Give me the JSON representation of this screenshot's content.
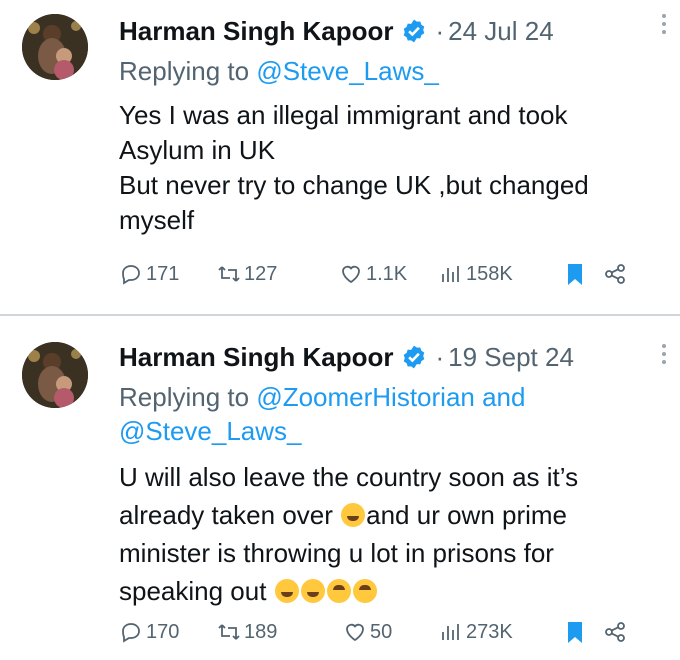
{
  "tweets": [
    {
      "author": "Harman Singh Kapoor",
      "date": "24 Jul 24",
      "reply_prefix": "Replying to ",
      "reply_handles": "@Steve_Laws_",
      "text_lines": [
        "Yes I was an illegal immigrant and took",
        "Asylum in UK",
        "But never try to change UK ,but changed",
        "myself"
      ],
      "replies": "171",
      "retweets": "127",
      "likes": "1.1K",
      "views": "158K"
    },
    {
      "author": "Harman Singh Kapoor",
      "date": "19 Sept 24",
      "reply_prefix": "Replying to ",
      "reply_handles_line1": "@ZoomerHistorian and",
      "reply_handles_line2": "@Steve_Laws_",
      "text_line1": "U will also leave the country soon as it’s",
      "text_line2a": "already taken over ",
      "text_line2b": "and ur own prime",
      "text_line3": "minister is throwing u lot in prisons for",
      "text_line4": "speaking out ",
      "replies": "170",
      "retweets": "189",
      "likes": "50",
      "views": "273K"
    }
  ],
  "icons": [
    "verified-badge-icon",
    "more-icon",
    "reply-icon",
    "retweet-icon",
    "like-icon",
    "views-icon",
    "bookmark-icon",
    "share-icon"
  ],
  "colors": {
    "accent": "#1d9bf0",
    "muted": "#536471",
    "text": "#0f1419"
  }
}
